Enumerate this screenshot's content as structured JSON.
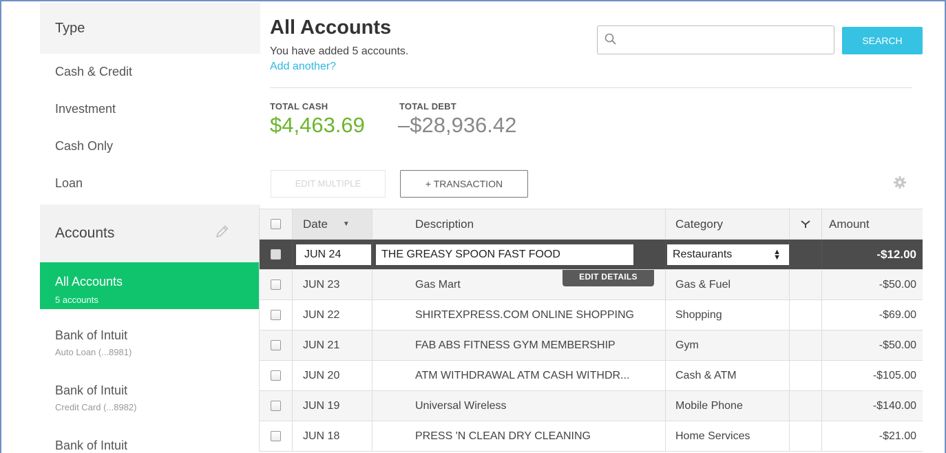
{
  "sidebar": {
    "type_heading": "Type",
    "types": [
      "Cash & Credit",
      "Investment",
      "Cash Only",
      "Loan"
    ],
    "accounts_heading": "Accounts",
    "active_account": {
      "name": "All Accounts",
      "sub": "5 accounts"
    },
    "accounts": [
      {
        "name": "Bank of Intuit",
        "sub": "Auto Loan (...8981)"
      },
      {
        "name": "Bank of Intuit",
        "sub": "Credit Card (...8982)"
      },
      {
        "name": "Bank of Intuit",
        "sub": ""
      }
    ]
  },
  "header": {
    "title": "All Accounts",
    "subtitle": "You have added 5 accounts.",
    "add_link": "Add another?",
    "search_placeholder": "",
    "search_button": "SEARCH"
  },
  "totals": {
    "cash_label": "TOTAL CASH",
    "cash_value": "$4,463.69",
    "debt_label": "TOTAL DEBT",
    "debt_value": "–$28,936.42"
  },
  "toolbar": {
    "edit_multiple": "EDIT MULTIPLE",
    "add_transaction": "+ TRANSACTION"
  },
  "table": {
    "columns": {
      "date": "Date",
      "description": "Description",
      "category": "Category",
      "amount": "Amount"
    },
    "edit_details": "EDIT DETAILS",
    "selected_row": {
      "date": "JUN 24",
      "description": "THE GREASY SPOON FAST FOOD",
      "category": "Restaurants",
      "amount": "-$12.00"
    },
    "rows": [
      {
        "date": "JUN 23",
        "description": "Gas Mart",
        "category": "Gas & Fuel",
        "amount": "-$50.00"
      },
      {
        "date": "JUN 22",
        "description": "SHIRTEXPRESS.COM ONLINE SHOPPING",
        "category": "Shopping",
        "amount": "-$69.00"
      },
      {
        "date": "JUN 21",
        "description": "FAB ABS FITNESS GYM MEMBERSHIP",
        "category": "Gym",
        "amount": "-$50.00"
      },
      {
        "date": "JUN 20",
        "description": "ATM WITHDRAWAL ATM CASH WITHDR...",
        "category": "Cash & ATM",
        "amount": "-$105.00"
      },
      {
        "date": "JUN 19",
        "description": "Universal Wireless",
        "category": "Mobile Phone",
        "amount": "-$140.00"
      },
      {
        "date": "JUN 18",
        "description": "PRESS 'N CLEAN DRY CLEANING",
        "category": "Home Services",
        "amount": "-$21.00"
      }
    ]
  },
  "colors": {
    "accent_green": "#10c46e",
    "cash_green": "#6cb52d",
    "search_blue": "#36c2e3",
    "link_blue": "#2cb8e0"
  }
}
